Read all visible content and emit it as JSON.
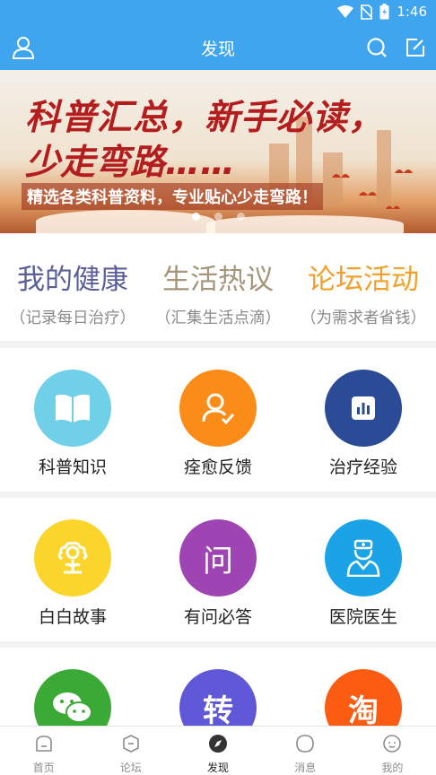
{
  "status_bar": {
    "time": "1:46",
    "icons": [
      "wifi-icon",
      "no-sim-icon",
      "battery-icon"
    ]
  },
  "app_bar": {
    "title": "发现",
    "icons": [
      "user-icon",
      "search-icon",
      "edit-icon"
    ],
    "background": "#3fa5ee"
  },
  "banner": {
    "line1": "科普汇总，新手必读，",
    "line2": "少走弯路……",
    "subtitle": "精选各类科普资料，专业贴心少走弯路！",
    "dots": 3,
    "active_dot": 0
  },
  "quick_links": [
    {
      "title": "我的健康",
      "subtitle": "（记录每日治疗）",
      "color": "#5b5f99"
    },
    {
      "title": "生活热议",
      "subtitle": "（汇集生活点滴）",
      "color": "#a5957a"
    },
    {
      "title": "论坛活动",
      "subtitle": "（为需求者省钱）",
      "color": "#f2a02a"
    }
  ],
  "grid": {
    "row1": [
      {
        "label": "科普知识",
        "icon": "book-icon",
        "color": "#6fd0e8"
      },
      {
        "label": "痊愈反馈",
        "icon": "user-check-icon",
        "color": "#fb8c17"
      },
      {
        "label": "治疗经验",
        "icon": "chart-icon",
        "color": "#2c4b97"
      }
    ],
    "row2": [
      {
        "label": "白白故事",
        "icon": "flower-icon",
        "color": "#fbd52c"
      },
      {
        "label": "有问必答",
        "icon": "question-icon",
        "glyph": "问",
        "color": "#9e44b3"
      },
      {
        "label": "医院医生",
        "icon": "doctor-icon",
        "color": "#1aa3e7"
      }
    ],
    "row3": [
      {
        "label": "",
        "icon": "wechat-icon",
        "color": "#3ba935"
      },
      {
        "label": "",
        "icon": "transfer-icon",
        "glyph": "转",
        "color": "#6056d8"
      },
      {
        "label": "",
        "icon": "taobao-icon",
        "glyph": "淘",
        "color": "#fc5b12"
      }
    ]
  },
  "bottom_nav": [
    {
      "label": "首页",
      "icon": "home-icon",
      "active": false
    },
    {
      "label": "论坛",
      "icon": "forum-icon",
      "active": false
    },
    {
      "label": "发现",
      "icon": "discover-icon",
      "active": true
    },
    {
      "label": "消息",
      "icon": "message-icon",
      "active": false
    },
    {
      "label": "我的",
      "icon": "profile-icon",
      "active": false
    }
  ]
}
